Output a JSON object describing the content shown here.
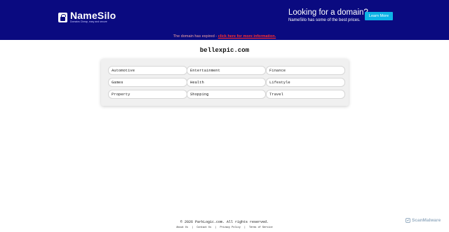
{
  "header": {
    "logo_name": "NameSilo",
    "logo_tagline": "Domains Cheap, easy and secure",
    "promo_title": "Looking for a domain?",
    "promo_subtitle": "NameSilo has some of the best prices.",
    "learn_more_label": "Learn More",
    "background_color": "#0a0a80",
    "button_color": "#0db3e6"
  },
  "notice": {
    "text": "The domain has expired - ",
    "link_text": "click here for more information."
  },
  "domain": "bellexpic.com",
  "categories": [
    "Automotive",
    "Entertainment",
    "Finance",
    "Games",
    "Health",
    "Lifestyle",
    "Property",
    "Shopping",
    "Travel"
  ],
  "footer": {
    "copyright": "© 2026 ParkLogic.com. All rights reserved.",
    "links": [
      "About Us",
      "Contact Us",
      "Privacy Policy",
      "Terms of Service"
    ],
    "separator": "|"
  },
  "badge": {
    "label": "ScanMalware",
    "icon": "shield-check-icon"
  }
}
